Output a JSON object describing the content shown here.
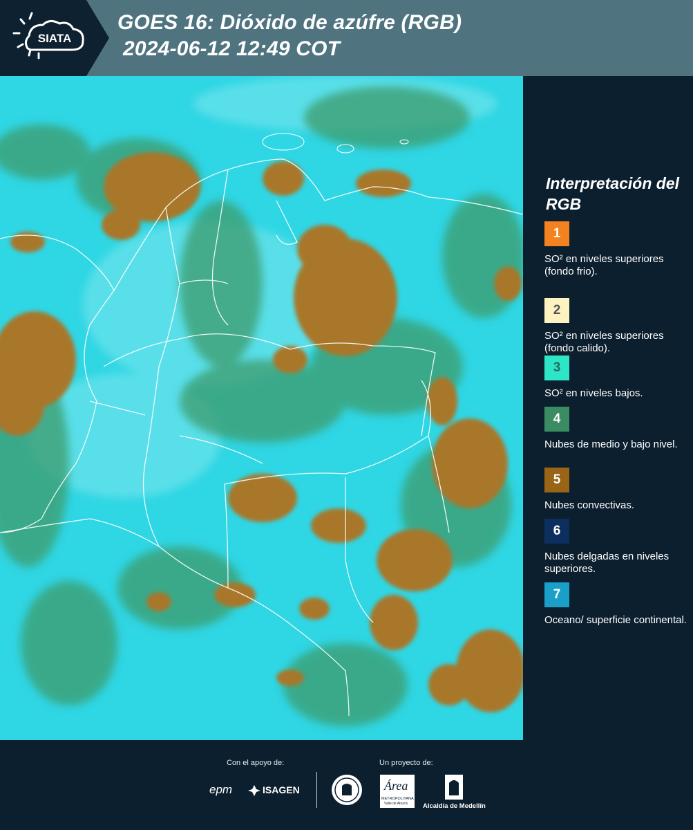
{
  "header": {
    "logo_text": "SIATA",
    "title_line1": "GOES 16: Dióxido de azúfre (RGB)",
    "title_line2": "2024-06-12 12:49 COT"
  },
  "map": {
    "icon": "satellite-map-image",
    "colors": {
      "background": "#2fd8e6",
      "cloud": "#a9782d",
      "low_cloud": "#3d9a6a"
    }
  },
  "legend": {
    "title": "Interpretación del RGB",
    "items": [
      {
        "num": "1",
        "label": "SO² en niveles superiores (fondo frio).",
        "color": "#f58220",
        "text_color": "#ffffff"
      },
      {
        "num": "2",
        "label": "SO² en niveles superiores (fondo calido).",
        "color": "#fdf3c0",
        "text_color": "#555555"
      },
      {
        "num": "3",
        "label": "SO² en niveles bajos.",
        "color": "#2de6c7",
        "text_color": "#2a6a60"
      },
      {
        "num": "4",
        "label": "Nubes de medio y bajo nivel.",
        "color": "#3b8b63",
        "text_color": "#ffffff"
      },
      {
        "num": "5",
        "label": "Nubes convectivas.",
        "color": "#9a6416",
        "text_color": "#ffffff"
      },
      {
        "num": "6",
        "label": "Nubes delgadas en niveles superiores.",
        "color": "#0c2f5f",
        "text_color": "#ffffff"
      },
      {
        "num": "7",
        "label": "Oceano/ superficie continental.",
        "color": "#1a9fc8",
        "text_color": "#ffffff"
      }
    ]
  },
  "footer": {
    "support_label": "Con el apoyo de:",
    "project_label": "Un proyecto de:",
    "epm": "epm",
    "isagen": "ISAGEN",
    "area": "Área",
    "area_sub": "METROPOLITANA",
    "area_sub2": "Valle de Aburrá",
    "alcaldia": "Alcaldía de Medellín"
  }
}
